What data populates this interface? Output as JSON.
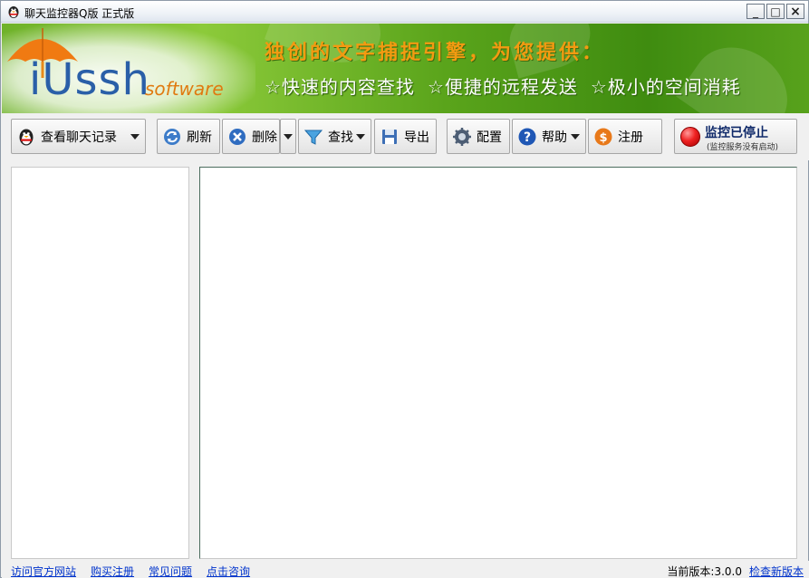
{
  "window": {
    "title": "聊天监控器Q版 正式版",
    "controls": {
      "minimize": "_",
      "maximize": "□",
      "close": "×"
    }
  },
  "banner": {
    "logo_text": "iUssh",
    "logo_sub": "software",
    "heading": "独创的文字捕捉引擎，为您提供：",
    "features": [
      "☆快速的内容查找",
      "☆便捷的远程发送",
      "☆极小的空间消耗"
    ]
  },
  "toolbar": {
    "view_records": {
      "label": "查看聊天记录",
      "icon": "qq-penguin-icon"
    },
    "refresh": {
      "label": "刷新",
      "icon": "refresh-icon"
    },
    "delete": {
      "label": "删除",
      "icon": "delete-icon"
    },
    "search": {
      "label": "查找",
      "icon": "funnel-icon"
    },
    "export": {
      "label": "导出",
      "icon": "export-icon"
    },
    "config": {
      "label": "配置",
      "icon": "gear-icon"
    },
    "help": {
      "label": "帮助",
      "icon": "help-icon"
    },
    "register": {
      "label": "注册",
      "icon": "dollar-icon"
    },
    "monitor": {
      "label": "监控已停止",
      "sublabel": "(监控服务没有启动)",
      "status_color": "#e02020"
    }
  },
  "statusbar": {
    "links": [
      "访问官方网站",
      "购买注册",
      "常见问题",
      "点击咨询"
    ],
    "version_label": "当前版本:3.0.0",
    "check_update": "检查新版本"
  },
  "colors": {
    "banner_green": "#5aa41b",
    "heading_orange": "#f39a11",
    "link_blue": "#0033cc"
  }
}
